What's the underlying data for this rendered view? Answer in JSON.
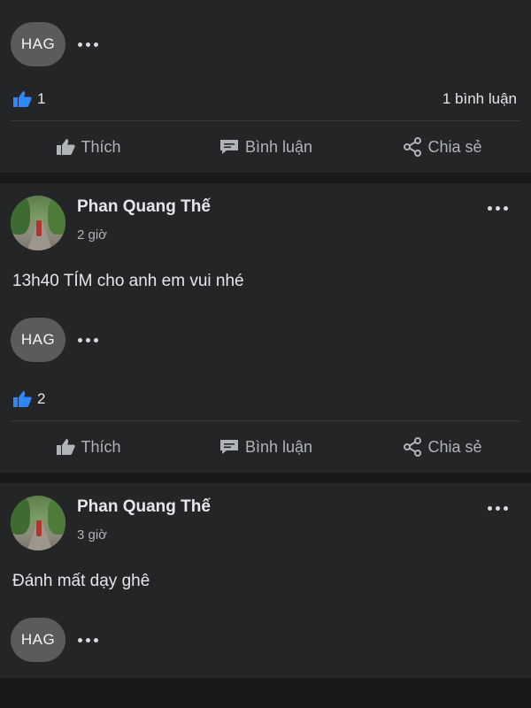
{
  "tag_label": "HAG",
  "icons": {
    "more": "more-dots-icon",
    "like_badge": "like-badge-icon",
    "like": "thumbs-up-icon",
    "comment": "comment-icon",
    "share": "share-icon"
  },
  "colors": {
    "like_blue": "#2d88ff",
    "text_secondary": "#b0b3b8"
  },
  "actions": {
    "like": "Thích",
    "comment": "Bình luận",
    "share": "Chia sẻ"
  },
  "posts": [
    {
      "likes": "1",
      "comments": "1 bình luận"
    },
    {
      "author": "Phan Quang Thế",
      "time": "2 giờ",
      "text": "13h40 TÍM cho anh em vui nhé",
      "likes": "2"
    },
    {
      "author": "Phan Quang Thế",
      "time": "3 giờ",
      "text": "Đánh mất dạy ghê"
    }
  ]
}
